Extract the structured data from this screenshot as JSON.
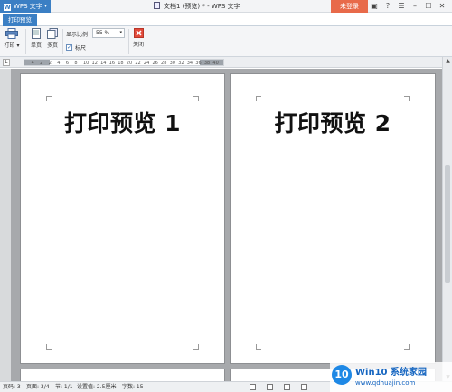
{
  "app": {
    "name": "WPS 文字",
    "window_title": "文档1 (预览) * - WPS 文字",
    "login_label": "未登录",
    "title_icons": [
      "skin-icon",
      "help-icon",
      "message-icon",
      "minimize-icon",
      "maximize-icon",
      "close-icon"
    ]
  },
  "tabs": {
    "active_label": "打印预览"
  },
  "ribbon": {
    "print_label": "打印",
    "single_page_label": "单页",
    "multi_page_label": "多页",
    "zoom_label": "显示比例",
    "zoom_value": "55 %",
    "ruler_label": "标尺",
    "ruler_checked": true,
    "close_label": "关闭"
  },
  "ruler": {
    "ticks": [
      "4",
      "2",
      "2",
      "4",
      "6",
      "8",
      "10",
      "12",
      "14",
      "16",
      "18",
      "20",
      "22",
      "24",
      "26",
      "28",
      "30",
      "32",
      "34",
      "36",
      "38",
      "40"
    ]
  },
  "pages": [
    {
      "title": "打印预览 1"
    },
    {
      "title": "打印预览 2"
    }
  ],
  "status": {
    "page": "页码: 3",
    "pages": "页面: 3/4",
    "section": "节: 1/1",
    "setting": "设置值: 2.5厘米",
    "words": "字数: 15"
  },
  "watermark": {
    "logo": "10",
    "title": "Win10 系统家园",
    "url": "www.qdhuajin.com"
  },
  "colors": {
    "accent": "#3b7fc4",
    "login": "#e86a4a",
    "workspace": "#a7a9ac"
  }
}
